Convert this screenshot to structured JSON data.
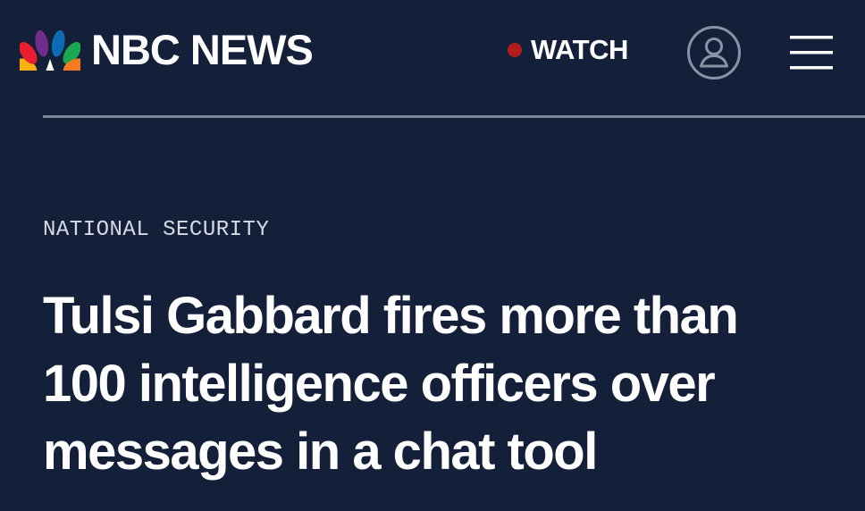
{
  "header": {
    "brand_name": "NBC NEWS",
    "logo_icon": "nbc-peacock-icon",
    "watch_label": "WATCH",
    "live_dot_color": "#b01c1c",
    "account_icon": "user-account-icon",
    "menu_icon": "hamburger-menu-icon"
  },
  "article": {
    "category": "NATIONAL SECURITY",
    "headline_lines": [
      "Tulsi Gabbard fires more than",
      "100 intelligence officers over",
      "messages in a chat tool"
    ]
  },
  "colors": {
    "background": "#142039",
    "text": "#ffffff",
    "divider": "#7d889c"
  }
}
